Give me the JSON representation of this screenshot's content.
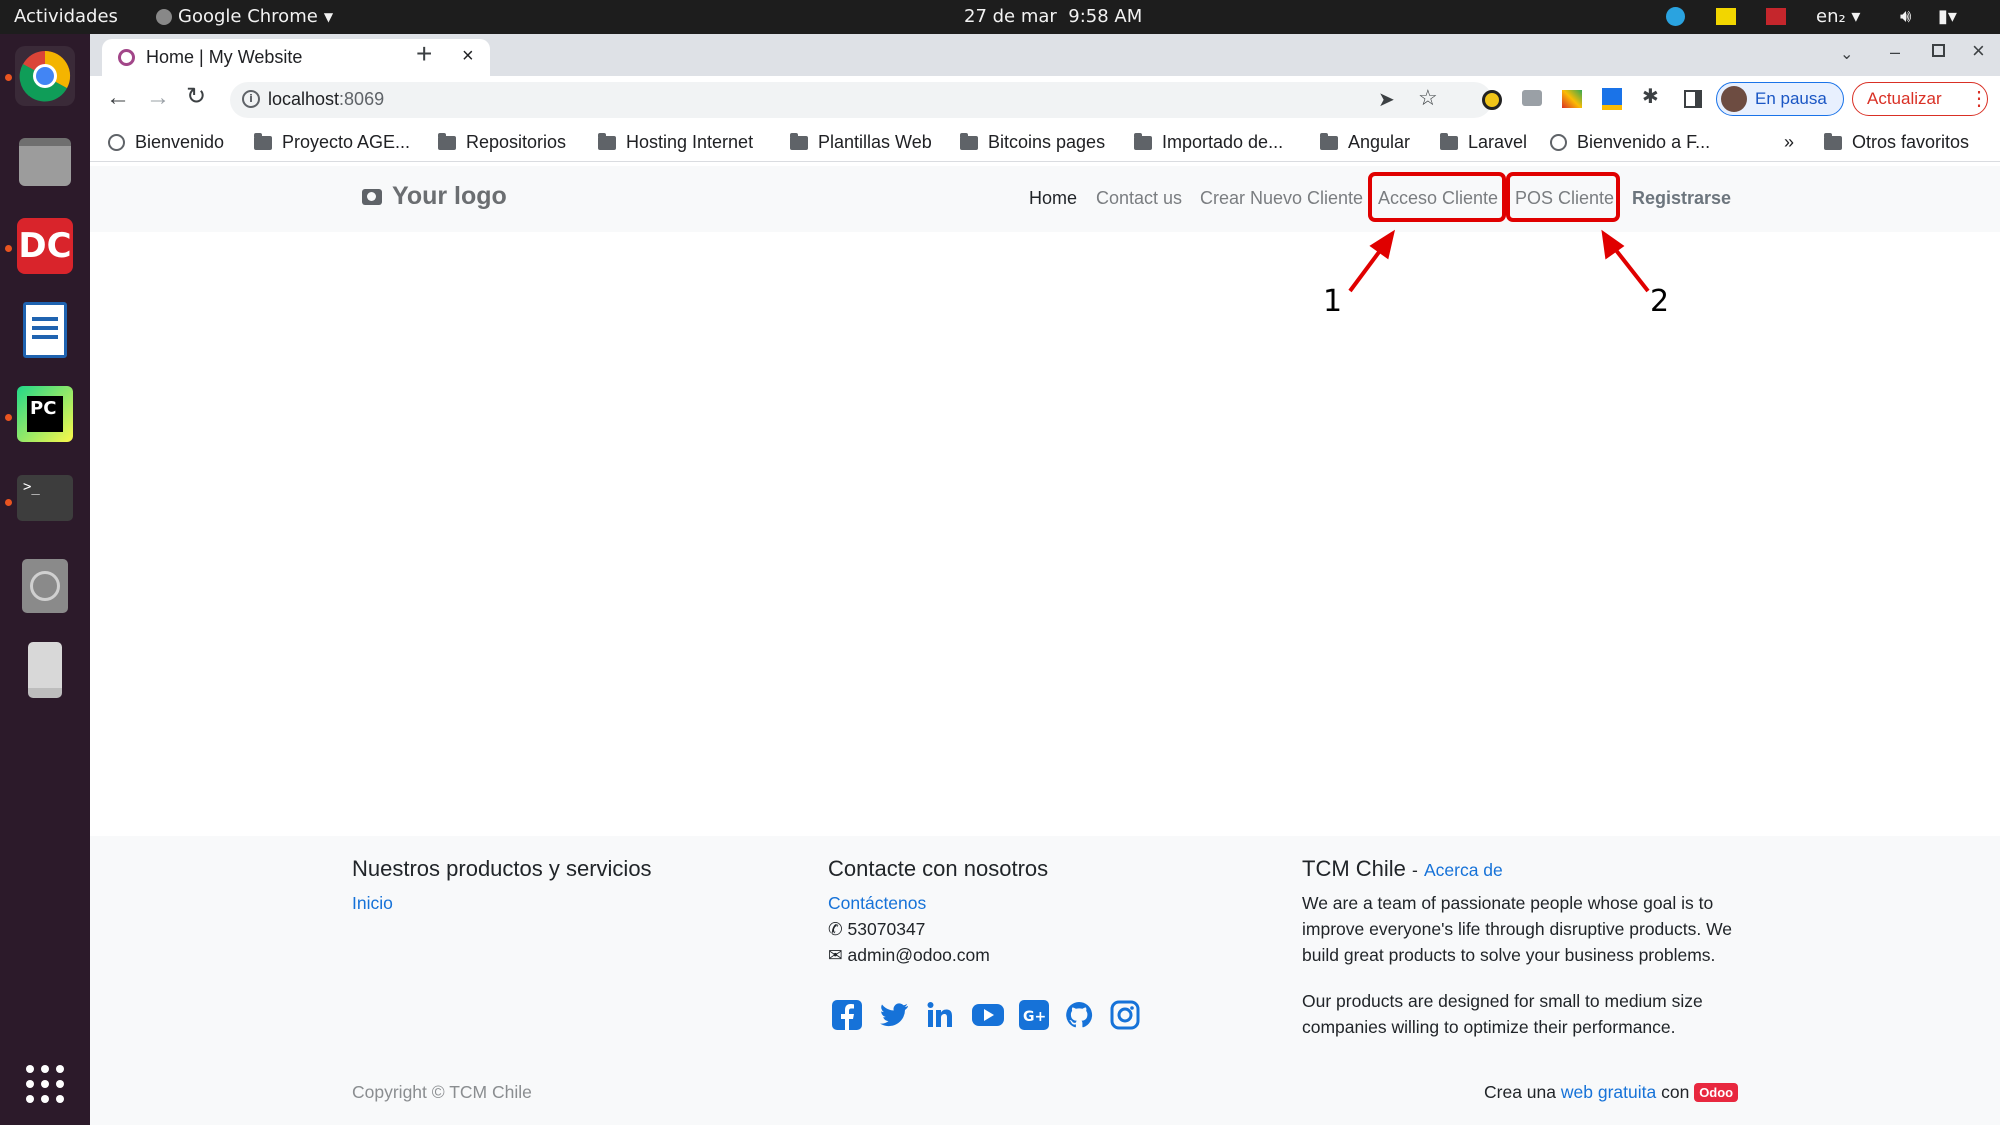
{
  "os": {
    "activities": "Actividades",
    "app_menu": "Google Chrome",
    "date": "27 de mar",
    "time": "9:58 AM",
    "lang": "en₂"
  },
  "browser": {
    "tab_title": "Home | My Website",
    "url_host": "localhost",
    "url_port": ":8069",
    "profile_label": "En pausa",
    "update_label": "Actualizar",
    "bookmarks": [
      "Bienvenido",
      "Proyecto AGE...",
      "Repositorios",
      "Hosting Internet",
      "Plantillas Web",
      "Bitcoins pages",
      "Importado de...",
      "Angular",
      "Laravel",
      "Bienvenido a F...",
      "»",
      "Otros favoritos"
    ]
  },
  "site": {
    "logo": "Your logo",
    "nav": [
      "Home",
      "Contact us",
      "Crear Nuevo Cliente",
      "Acceso Cliente",
      "POS Cliente",
      "Registrarse"
    ],
    "annotations": [
      "1",
      "2"
    ],
    "footer": {
      "col1_title": "Nuestros productos y servicios",
      "col1_link": "Inicio",
      "col2_title": "Contacte con nosotros",
      "col2_link": "Contáctenos",
      "phone": "53070347",
      "email": "admin@odoo.com",
      "col3_title": "TCM Chile",
      "col3_sep": "-",
      "col3_link": "Acerca de",
      "about_1a": "We are a team of passionate people whose goal is to",
      "about_1b": "improve everyone's life through disruptive products. We",
      "about_1c": "build great products to solve your business problems.",
      "about_2a": "Our products are designed for small to medium size",
      "about_2b": "companies willing to optimize their performance.",
      "copyright": "Copyright © TCM Chile",
      "made_prefix": "Crea una",
      "made_link": "web gratuita",
      "made_con": "con",
      "odoo_badge": "Odoo"
    }
  },
  "colors": {
    "highlight": "#e00000",
    "link": "#1672d8",
    "social": "#1672d8",
    "odoo_badge": "#e8283f"
  }
}
